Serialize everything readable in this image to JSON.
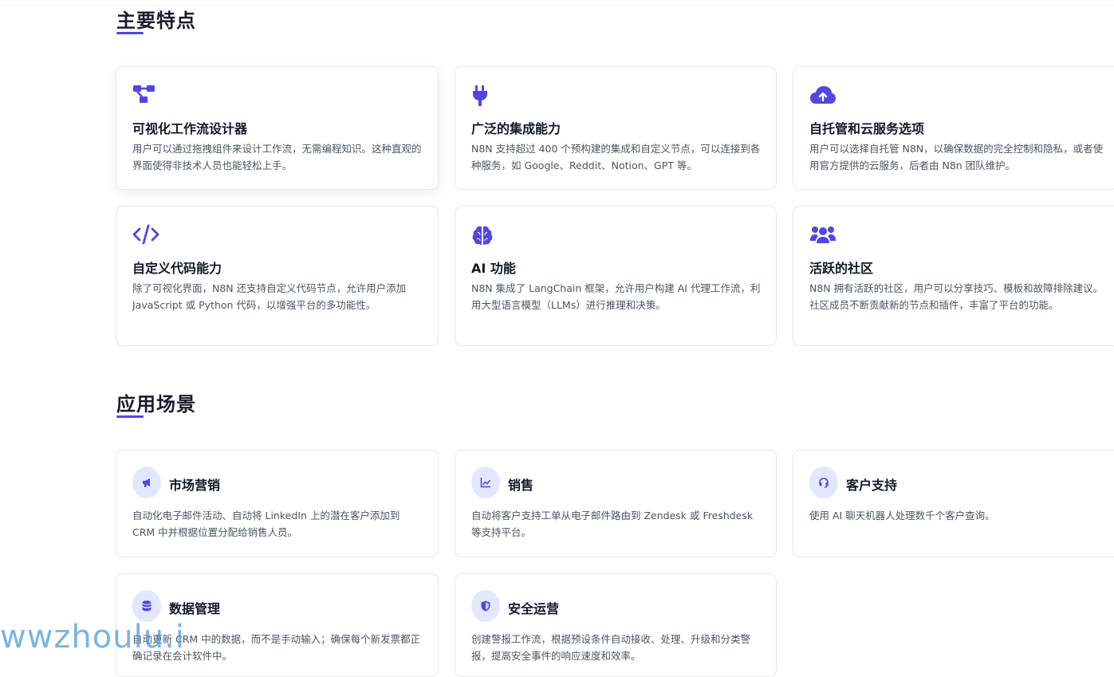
{
  "features": {
    "title": "主要特点",
    "cards": [
      {
        "icon": "workflow-icon",
        "title": "可视化工作流设计器",
        "desc": "用户可以通过拖拽组件来设计工作流，无需编程知识。这种直观的界面使得非技术人员也能轻松上手。"
      },
      {
        "icon": "plug-icon",
        "title": "广泛的集成能力",
        "desc": "N8N 支持超过 400 个预构建的集成和自定义节点，可以连接到各种服务，如 Google、Reddit、Notion、GPT 等。"
      },
      {
        "icon": "cloud-upload-icon",
        "title": "自托管和云服务选项",
        "desc": "用户可以选择自托管 N8N，以确保数据的完全控制和隐私，或者使用官方提供的云服务，后者由 N8n 团队维护。"
      },
      {
        "icon": "code-icon",
        "title": "自定义代码能力",
        "desc": "除了可视化界面，N8N 还支持自定义代码节点，允许用户添加 JavaScript 或 Python 代码，以增强平台的多功能性。"
      },
      {
        "icon": "brain-icon",
        "title": "AI 功能",
        "desc": "N8N 集成了 LangChain 框架，允许用户构建 AI 代理工作流，利用大型语言模型（LLMs）进行推理和决策。"
      },
      {
        "icon": "users-icon",
        "title": "活跃的社区",
        "desc": "N8N 拥有活跃的社区，用户可以分享技巧、模板和故障排除建议。社区成员不断贡献新的节点和插件，丰富了平台的功能。"
      }
    ]
  },
  "usecases": {
    "title": "应用场景",
    "cards": [
      {
        "icon": "megaphone-icon",
        "title": "市场营销",
        "desc": "自动化电子邮件活动、自动将 LinkedIn 上的潜在客户添加到 CRM 中并根据位置分配给销售人员。"
      },
      {
        "icon": "chart-line-icon",
        "title": "销售",
        "desc": "自动将客户支持工单从电子邮件路由到 Zendesk 或 Freshdesk 等支持平台。"
      },
      {
        "icon": "headset-icon",
        "title": "客户支持",
        "desc": "使用 AI 聊天机器人处理数千个客户查询。"
      },
      {
        "icon": "database-icon",
        "title": "数据管理",
        "desc": "自动更新 CRM 中的数据，而不是手动输入；确保每个新发票都正确记录在会计软件中。"
      },
      {
        "icon": "shield-icon",
        "title": "安全运营",
        "desc": "创建警报工作流，根据预设条件自动接收、处理、升级和分类警报，提高安全事件的响应速度和效率。"
      }
    ]
  },
  "watermark": "wwzhoulu.i",
  "colors": {
    "accent": "#4f46e5",
    "icon_bg": "#e3e7fd"
  }
}
